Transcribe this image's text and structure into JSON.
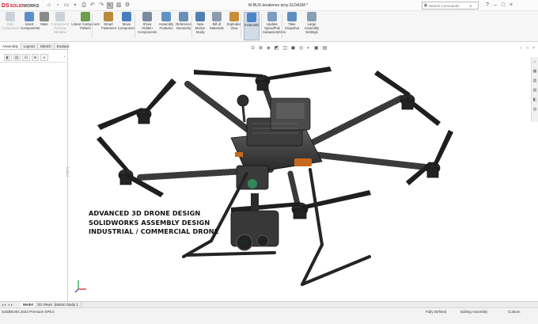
{
  "titlebar": {
    "brand_mark": "DS",
    "brand_prefix": "SOLID",
    "brand_suffix": "WORKS",
    "document_title": "M-BUS tenalenes arny.SLDASM *",
    "search_placeholder": "Search Commands",
    "quick_access_icons": [
      "home-icon",
      "new-icon",
      "open-icon",
      "save-icon",
      "print-icon",
      "undo-icon",
      "redo-icon",
      "select-icon",
      "rebuild-icon",
      "options-icon"
    ]
  },
  "commands": [
    {
      "id": "edit-component",
      "label": "Edit Component",
      "enabled": false,
      "color": "#9aa6b2"
    },
    {
      "id": "insert-components",
      "label": "Insert Components",
      "enabled": true,
      "color": "#5b8fc9"
    },
    {
      "id": "mate",
      "label": "Mate",
      "enabled": true,
      "color": "#8a8a8a"
    },
    {
      "id": "component-preview",
      "label": "Component Preview Window",
      "enabled": false,
      "color": "#9aa6b2"
    },
    {
      "id": "linear-pattern",
      "label": "Linear Component Pattern",
      "enabled": true,
      "color": "#6d9d4d"
    },
    {
      "id": "smart-fasteners",
      "label": "Smart Fasteners",
      "enabled": true,
      "color": "#b88a3a"
    },
    {
      "id": "move-component",
      "label": "Move Component",
      "enabled": true,
      "color": "#4a7fbf"
    },
    {
      "id": "show-hidden",
      "label": "Show Hidden Components",
      "enabled": true,
      "color": "#7a8aa0"
    },
    {
      "id": "assembly-features",
      "label": "Assembly Features",
      "enabled": true,
      "color": "#5f93c6"
    },
    {
      "id": "reference-geometry",
      "label": "Reference Geometry",
      "enabled": true,
      "color": "#6c8fb8"
    },
    {
      "id": "new-motion-study",
      "label": "New Motion Study",
      "enabled": true,
      "color": "#4f7fb0"
    },
    {
      "id": "bill-of-materials",
      "label": "Bill of Materials",
      "enabled": true,
      "color": "#8b9bb0"
    },
    {
      "id": "exploded-view",
      "label": "Exploded View",
      "enabled": true,
      "color": "#c98d3a"
    },
    {
      "id": "instant3d",
      "label": "Instant3D",
      "enabled": true,
      "selected": true,
      "color": "#4d86c8"
    },
    {
      "id": "update-speedpak",
      "label": "Update SpeedPak Subassemblies",
      "enabled": true,
      "color": "#7d9cc0"
    },
    {
      "id": "take-snapshot",
      "label": "Take Snapshot",
      "enabled": true,
      "color": "#5c8ec4"
    },
    {
      "id": "large-assembly",
      "label": "Large Assembly Settings",
      "enabled": true,
      "color": "#8a9fb5"
    }
  ],
  "cmd_tabs": [
    "Assembly",
    "Layout",
    "Sketch",
    "Evaluate"
  ],
  "panel_tabs": [
    "feature-manager-icon",
    "property-manager-icon",
    "configuration-manager-icon",
    "dimxpert-icon",
    "display-manager-icon"
  ],
  "viewport": {
    "caption_lines": [
      "ADVANCED 3D DRONE DESIGN",
      "SOLIDWORKS ASSEMBLY DESIGN",
      "INDUSTRIAL / COMMERCIAL DRONE"
    ],
    "hud_icons": [
      "zoom-fit-icon",
      "zoom-area-icon",
      "previous-view-icon",
      "section-view-icon",
      "view-orientation-icon",
      "display-style-icon",
      "hide-show-icon",
      "edit-appearance-icon",
      "apply-scene-icon",
      "view-settings-icon"
    ],
    "background": "#ffffff"
  },
  "bottom_tabs": [
    "Model",
    "3D Views",
    "Motion Study 1"
  ],
  "status": {
    "app_version": "SolidWorks 2024 Premium SP5.0",
    "fully_defined": "Fully Defined",
    "editing": "Editing Assembly",
    "units": "Custom"
  },
  "colors": {
    "brand_red": "#d1122a",
    "drone_body": "#3a3a3a",
    "accent_orange": "#c86a1e",
    "lens_green": "#2f8a57"
  }
}
